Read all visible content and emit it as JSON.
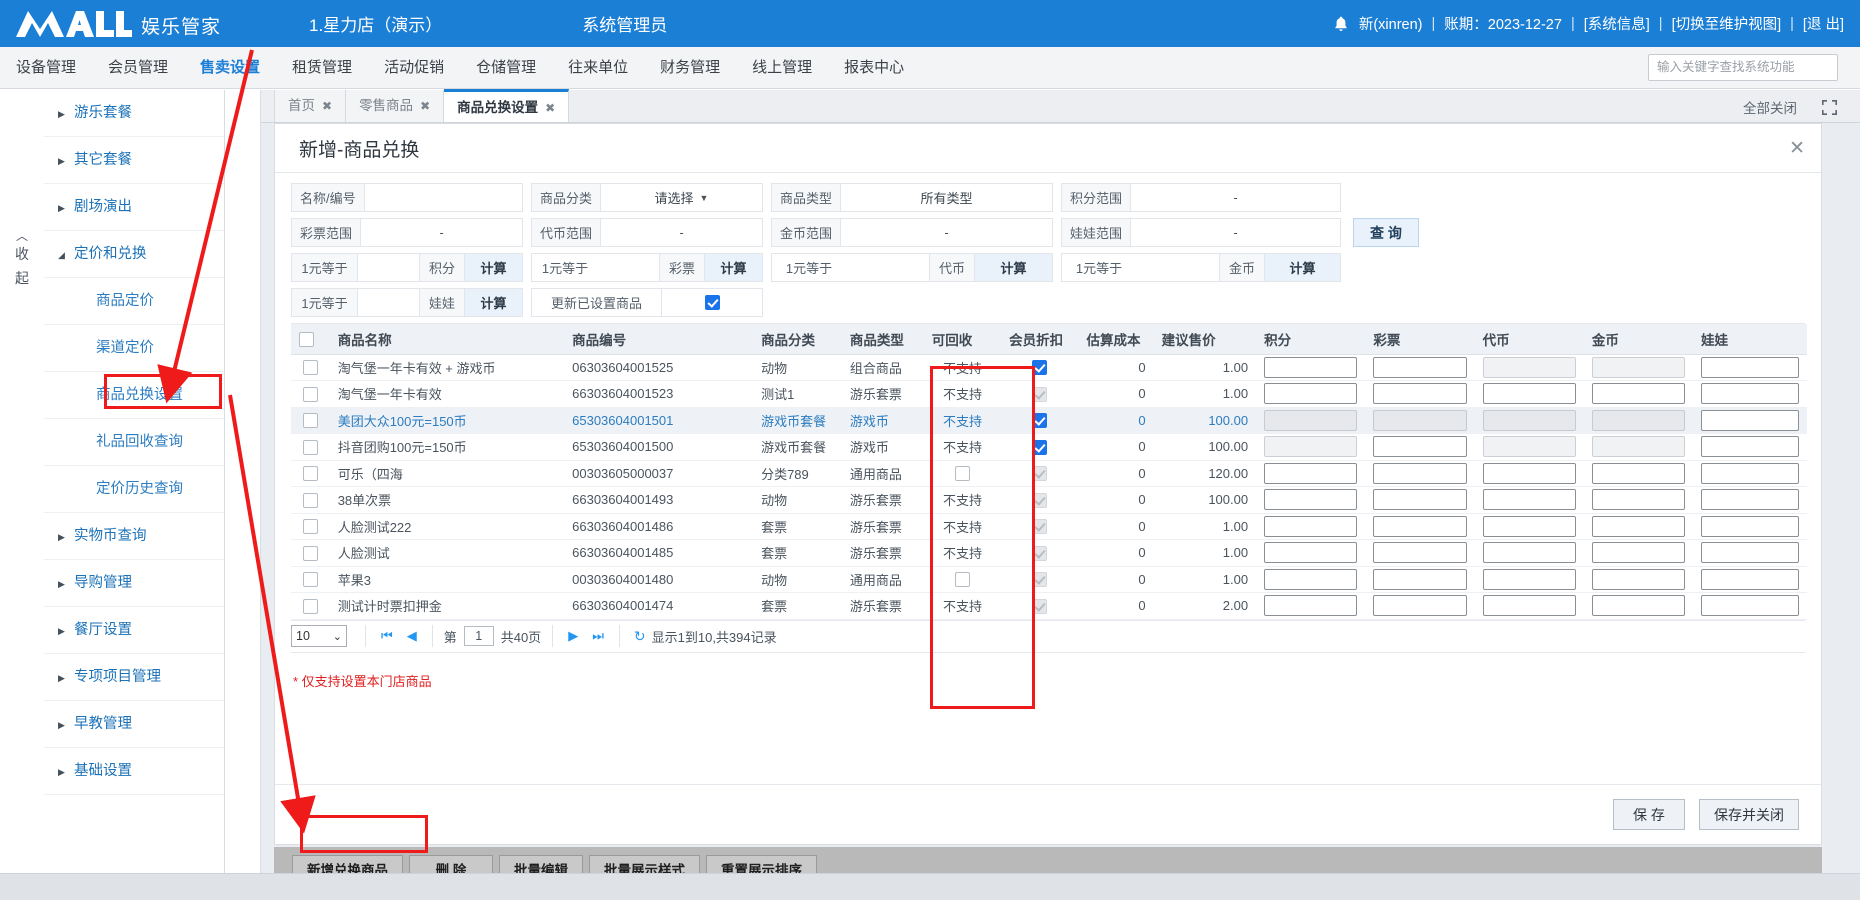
{
  "header": {
    "logo_text": "MALL",
    "logo_sub": "娱乐管家",
    "store": "1.星力店（演示）",
    "role": "系统管理员",
    "bell_icon": "bell-icon",
    "user": "新(xinren)",
    "period_label": "账期：2023-12-27",
    "system_info": "[系统信息]",
    "switch_view": "[切换至维护视图]",
    "logout": "[退 出]",
    "sep": "|"
  },
  "menu": {
    "items": [
      {
        "label": "设备管理",
        "active": false
      },
      {
        "label": "会员管理",
        "active": false
      },
      {
        "label": "售卖设置",
        "active": true
      },
      {
        "label": "租赁管理",
        "active": false
      },
      {
        "label": "活动促销",
        "active": false
      },
      {
        "label": "仓储管理",
        "active": false
      },
      {
        "label": "往来单位",
        "active": false
      },
      {
        "label": "财务管理",
        "active": false
      },
      {
        "label": "线上管理",
        "active": false
      },
      {
        "label": "报表中心",
        "active": false
      }
    ],
    "search_placeholder": "输入关键字查找系统功能"
  },
  "sidebar": {
    "collapse_label_1": "收",
    "collapse_label_2": "起",
    "collapse_caret": "︿",
    "items": [
      {
        "label": "游乐套餐",
        "type": "group",
        "expanded": false
      },
      {
        "label": "其它套餐",
        "type": "group",
        "expanded": false
      },
      {
        "label": "剧场演出",
        "type": "group",
        "expanded": false
      },
      {
        "label": "定价和兑换",
        "type": "group",
        "expanded": true
      },
      {
        "label": "商品定价",
        "type": "child"
      },
      {
        "label": "渠道定价",
        "type": "child"
      },
      {
        "label": "商品兑换设置",
        "type": "child"
      },
      {
        "label": "礼品回收查询",
        "type": "child"
      },
      {
        "label": "定价历史查询",
        "type": "child"
      },
      {
        "label": "实物币查询",
        "type": "group",
        "expanded": false
      },
      {
        "label": "导购管理",
        "type": "group",
        "expanded": false
      },
      {
        "label": "餐厅设置",
        "type": "group",
        "expanded": false
      },
      {
        "label": "专项项目管理",
        "type": "group",
        "expanded": false
      },
      {
        "label": "早教管理",
        "type": "group",
        "expanded": false
      },
      {
        "label": "基础设置",
        "type": "group",
        "expanded": false
      }
    ],
    "arrow_collapsed": "▶",
    "arrow_expanded": "◢"
  },
  "tabs": {
    "items": [
      {
        "label": "首页",
        "active": false
      },
      {
        "label": "零售商品",
        "active": false
      },
      {
        "label": "商品兑换设置",
        "active": true
      }
    ],
    "close_glyph": "✖",
    "close_all": "全部关闭",
    "maximize_icon": "maximize-icon"
  },
  "panel": {
    "title": "新增-商品兑换",
    "close_glyph": "✕"
  },
  "filters": {
    "name_code": {
      "label": "名称/编号",
      "value": ""
    },
    "category": {
      "label": "商品分类",
      "value": "请选择",
      "caret": "▼"
    },
    "goods_type": {
      "label": "商品类型",
      "value": "所有类型"
    },
    "point_range": {
      "label": "积分范围",
      "value": "-"
    },
    "ticket_range": {
      "label": "彩票范围",
      "value": "-"
    },
    "token_range": {
      "label": "代币范围",
      "value": "-"
    },
    "coin_range": {
      "label": "金币范围",
      "value": "-"
    },
    "doll_range": {
      "label": "娃娃范围",
      "value": "-"
    },
    "query_button": "查 询",
    "rate_prefix": "1元等于",
    "calc_button": "计算",
    "rates": [
      {
        "unit": "积分",
        "value": ""
      },
      {
        "unit": "彩票",
        "value": ""
      },
      {
        "unit": "代币",
        "value": ""
      },
      {
        "unit": "金币",
        "value": ""
      },
      {
        "unit": "娃娃",
        "value": ""
      }
    ],
    "update_set_goods": {
      "label": "更新已设置商品",
      "checked": true
    }
  },
  "table": {
    "columns": [
      "商品名称",
      "商品编号",
      "商品分类",
      "商品类型",
      "可回收",
      "会员折扣",
      "估算成本",
      "建议售价",
      "积分",
      "彩票",
      "代币",
      "金币",
      "娃娃"
    ],
    "rows": [
      {
        "name": "淘气堡一年卡有效 + 游戏币",
        "code": "06303604001525",
        "category": "动物",
        "type": "组合商品",
        "recyclable": "不支持",
        "discount": true,
        "discount_disabled": false,
        "cost": "0",
        "price": "1.00",
        "selected": false,
        "inputs": {
          "point": "",
          "ticket": "",
          "token": "",
          "coin": "",
          "doll": ""
        },
        "dim": {
          "point": false,
          "ticket": false,
          "token": true,
          "coin": true,
          "doll": false
        }
      },
      {
        "name": "淘气堡一年卡有效",
        "code": "66303604001523",
        "category": "测试1",
        "type": "游乐套票",
        "recyclable": "不支持",
        "discount": true,
        "discount_disabled": true,
        "cost": "0",
        "price": "1.00",
        "selected": false,
        "inputs": {
          "point": "",
          "ticket": "",
          "token": "",
          "coin": "",
          "doll": ""
        },
        "dim": {
          "point": false,
          "ticket": false,
          "token": false,
          "coin": false,
          "doll": false
        }
      },
      {
        "name": "美团大众100元=150币",
        "code": "65303604001501",
        "category": "游戏币套餐",
        "type": "游戏币",
        "recyclable": "不支持",
        "discount": true,
        "discount_disabled": false,
        "cost": "0",
        "price": "100.00",
        "selected": true,
        "inputs": {
          "point": "",
          "ticket": "",
          "token": "",
          "coin": "",
          "doll": ""
        },
        "dim": {
          "point": true,
          "ticket": true,
          "token": true,
          "coin": true,
          "doll": false
        }
      },
      {
        "name": "抖音团购100元=150币",
        "code": "65303604001500",
        "category": "游戏币套餐",
        "type": "游戏币",
        "recyclable": "不支持",
        "discount": true,
        "discount_disabled": false,
        "cost": "0",
        "price": "100.00",
        "selected": false,
        "inputs": {
          "point": "",
          "ticket": "",
          "token": "",
          "coin": "",
          "doll": ""
        },
        "dim": {
          "point": true,
          "ticket": false,
          "token": true,
          "coin": true,
          "doll": false
        }
      },
      {
        "name": "可乐（四海",
        "code": "00303605000037",
        "category": "分类789",
        "type": "通用商品",
        "recyclable": "",
        "recycle_checkbox": false,
        "discount": true,
        "discount_disabled": true,
        "cost": "0",
        "price": "120.00",
        "selected": false,
        "inputs": {
          "point": "",
          "ticket": "",
          "token": "",
          "coin": "",
          "doll": ""
        },
        "dim": {
          "point": false,
          "ticket": false,
          "token": false,
          "coin": false,
          "doll": false
        }
      },
      {
        "name": "38单次票",
        "code": "66303604001493",
        "category": "动物",
        "type": "游乐套票",
        "recyclable": "不支持",
        "discount": true,
        "discount_disabled": true,
        "cost": "0",
        "price": "100.00",
        "selected": false,
        "inputs": {
          "point": "",
          "ticket": "",
          "token": "",
          "coin": "",
          "doll": ""
        },
        "dim": {
          "point": false,
          "ticket": false,
          "token": false,
          "coin": false,
          "doll": false
        }
      },
      {
        "name": "人脸测试222",
        "code": "66303604001486",
        "category": "套票",
        "type": "游乐套票",
        "recyclable": "不支持",
        "discount": true,
        "discount_disabled": true,
        "cost": "0",
        "price": "1.00",
        "selected": false,
        "inputs": {
          "point": "",
          "ticket": "",
          "token": "",
          "coin": "",
          "doll": ""
        },
        "dim": {
          "point": false,
          "ticket": false,
          "token": false,
          "coin": false,
          "doll": false
        }
      },
      {
        "name": "人脸测试",
        "code": "66303604001485",
        "category": "套票",
        "type": "游乐套票",
        "recyclable": "不支持",
        "discount": true,
        "discount_disabled": true,
        "cost": "0",
        "price": "1.00",
        "selected": false,
        "inputs": {
          "point": "",
          "ticket": "",
          "token": "",
          "coin": "",
          "doll": ""
        },
        "dim": {
          "point": false,
          "ticket": false,
          "token": false,
          "coin": false,
          "doll": false
        }
      },
      {
        "name": "苹果3",
        "code": "00303604001480",
        "category": "动物",
        "type": "通用商品",
        "recyclable": "",
        "recycle_checkbox": false,
        "discount": true,
        "discount_disabled": true,
        "cost": "0",
        "price": "1.00",
        "selected": false,
        "inputs": {
          "point": "",
          "ticket": "",
          "token": "",
          "coin": "",
          "doll": ""
        },
        "dim": {
          "point": false,
          "ticket": false,
          "token": false,
          "coin": false,
          "doll": false
        }
      },
      {
        "name": "测试计时票扣押金",
        "code": "66303604001474",
        "category": "套票",
        "type": "游乐套票",
        "recyclable": "不支持",
        "discount": true,
        "discount_disabled": true,
        "cost": "0",
        "price": "2.00",
        "selected": false,
        "inputs": {
          "point": "",
          "ticket": "",
          "token": "",
          "coin": "",
          "doll": ""
        },
        "dim": {
          "point": false,
          "ticket": false,
          "token": false,
          "coin": false,
          "doll": false
        }
      }
    ]
  },
  "pagination": {
    "page_size": "10",
    "page_size_caret": "⌄",
    "first_icon": "first-page-icon",
    "prev_icon": "prev-page-icon",
    "next_icon": "next-page-icon",
    "last_icon": "last-page-icon",
    "refresh_icon": "refresh-icon",
    "page_prefix": "第",
    "page_number": "1",
    "page_total": "共40页",
    "summary": "显示1到10,共394记录"
  },
  "footer": {
    "note": "* 仅支持设置本门店商品",
    "save": "保 存",
    "save_close": "保存并关闭"
  },
  "action_bar": {
    "buttons": [
      "新增兑换商品",
      "删 除",
      "批量编辑",
      "批量展示样式",
      "重置展示排序"
    ],
    "highlighted": "新增兑换商品"
  },
  "colors": {
    "brand_blue": "#1c7fd6",
    "accent_blue": "#1a73e8",
    "annotation_red": "#ef1b1b",
    "link_blue": "#1b72b8"
  }
}
